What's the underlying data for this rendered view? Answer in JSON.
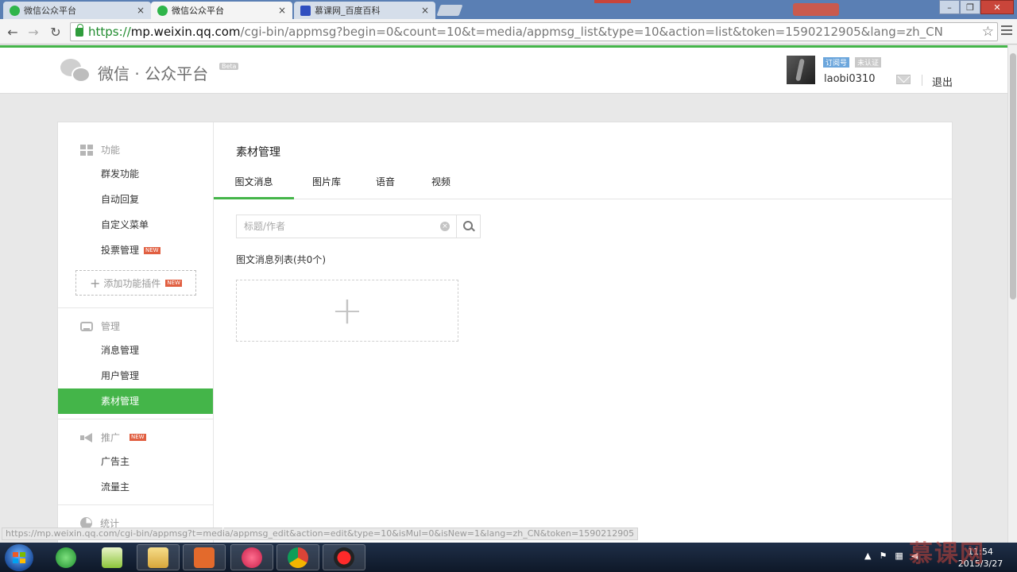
{
  "browser": {
    "tabs": [
      {
        "title": "微信公众平台",
        "active": false,
        "favicon": "wechat-favicon"
      },
      {
        "title": "微信公众平台",
        "active": true,
        "favicon": "wechat-favicon"
      },
      {
        "title": "慕课网_百度百科",
        "active": false,
        "favicon": "baidu-favicon"
      }
    ],
    "close_glyph": "×",
    "url_scheme": "https://",
    "url_host": "mp.weixin.qq.com",
    "url_path": "/cgi-bin/appmsg?begin=0&count=10&t=media/appmsg_list&type=10&action=list&token=1590212905&lang=zh_CN",
    "status_url": "https://mp.weixin.qq.com/cgi-bin/appmsg?t=media/appmsg_edit&action=edit&type=10&isMul=0&isNew=1&lang=zh_CN&token=1590212905"
  },
  "header": {
    "logo_text": "微信 · 公众平台",
    "beta": "Beta",
    "account_type_badge": "订阅号",
    "verify_badge": "未认证",
    "username": "laobi0310",
    "logout": "退出"
  },
  "sidebar": {
    "groups": [
      {
        "title": "功能",
        "icon": "grid-icon",
        "items": [
          {
            "label": "群发功能"
          },
          {
            "label": "自动回复"
          },
          {
            "label": "自定义菜单"
          },
          {
            "label": "投票管理",
            "badge": "NEW"
          }
        ]
      },
      {
        "title": "管理",
        "icon": "tray-icon",
        "items": [
          {
            "label": "消息管理"
          },
          {
            "label": "用户管理"
          },
          {
            "label": "素材管理",
            "active": true
          }
        ]
      },
      {
        "title": "推广",
        "icon": "megaphone-icon",
        "badge": "NEW",
        "items": [
          {
            "label": "广告主"
          },
          {
            "label": "流量主"
          }
        ]
      },
      {
        "title": "统计",
        "icon": "pie-chart-icon",
        "items": []
      }
    ],
    "add_plugin": {
      "label": "添加功能插件",
      "badge": "NEW"
    }
  },
  "main": {
    "title": "素材管理",
    "tabs": [
      {
        "label": "图文消息",
        "active": true
      },
      {
        "label": "图片库"
      },
      {
        "label": "语音"
      },
      {
        "label": "视频"
      }
    ],
    "search": {
      "placeholder": "标题/作者",
      "value": ""
    },
    "list_title": "图文消息列表(共0个)",
    "add_card_glyph": "+"
  },
  "taskbar": {
    "time": "11:54",
    "date": "2015/3/27",
    "apps": [
      "start-button",
      "ie-icon",
      "notepad-icon",
      "file-explorer-icon",
      "powerpoint-icon",
      "bug-app-icon",
      "chrome-icon",
      "record-icon"
    ]
  },
  "watermark": "慕课网",
  "colors": {
    "accent": "#44b549",
    "new_badge": "#e15f41",
    "tabstrip": "#5a7fb4"
  }
}
